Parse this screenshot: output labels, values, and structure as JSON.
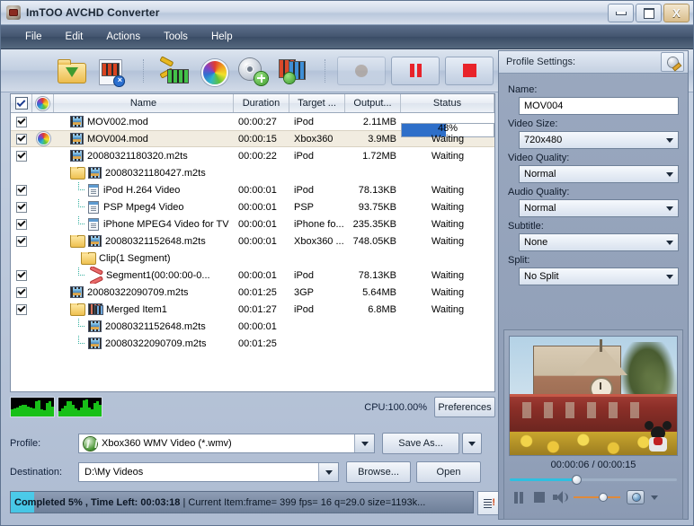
{
  "window": {
    "title": "ImTOO AVCHD Converter",
    "minimize_label": "Minimize",
    "maximize_label": "Maximize",
    "close_label": "X"
  },
  "menu": [
    {
      "label": "File"
    },
    {
      "label": "Edit"
    },
    {
      "label": "Actions"
    },
    {
      "label": "Tools"
    },
    {
      "label": "Help"
    }
  ],
  "toolbar": [
    {
      "name": "add-file",
      "icon": "folder-open-icon"
    },
    {
      "name": "remove-file",
      "icon": "film-delete-icon"
    },
    {
      "name": "clip",
      "icon": "scissors-film-icon"
    },
    {
      "name": "effect",
      "icon": "color-wheel-icon"
    },
    {
      "name": "settings",
      "icon": "gear-plus-icon"
    },
    {
      "name": "merge",
      "icon": "merge-films-icon"
    },
    {
      "name": "record",
      "icon": "record-dot-icon"
    },
    {
      "name": "pause",
      "icon": "pause-bars-icon"
    },
    {
      "name": "stop",
      "icon": "stop-square-icon"
    }
  ],
  "list": {
    "columns": [
      "",
      "",
      "Name",
      "Duration",
      "Target ...",
      "Output...",
      "Status"
    ],
    "rows": [
      {
        "checked": true,
        "wheel": false,
        "indent": 0,
        "icon": "film-icon",
        "name": "MOV002.mod",
        "duration": "00:00:27",
        "target": "iPod",
        "output": "2.11MB",
        "status": "48%",
        "progress": 48
      },
      {
        "checked": true,
        "wheel": true,
        "indent": 0,
        "icon": "film-icon",
        "name": "MOV004.mod",
        "duration": "00:00:15",
        "target": "Xbox360",
        "output": "3.9MB",
        "status": "Waiting",
        "selected": true
      },
      {
        "checked": true,
        "wheel": false,
        "indent": 0,
        "icon": "film-icon",
        "name": "20080321180320.m2ts",
        "duration": "00:00:22",
        "target": "iPod",
        "output": "1.72MB",
        "status": "Waiting"
      },
      {
        "checked": false,
        "wheel": false,
        "indent": 0,
        "icon": "folder-film-icon",
        "name": "20080321180427.m2ts",
        "duration": "",
        "target": "",
        "output": "",
        "status": ""
      },
      {
        "checked": true,
        "wheel": false,
        "indent": 1,
        "icon": "profile-doc-icon",
        "name": "iPod H.264 Video",
        "duration": "00:00:01",
        "target": "iPod",
        "output": "78.13KB",
        "status": "Waiting"
      },
      {
        "checked": true,
        "wheel": false,
        "indent": 1,
        "icon": "profile-doc-icon",
        "name": "PSP Mpeg4 Video",
        "duration": "00:00:01",
        "target": "PSP",
        "output": "93.75KB",
        "status": "Waiting"
      },
      {
        "checked": true,
        "wheel": false,
        "indent": 1,
        "icon": "profile-doc-icon",
        "name": "iPhone MPEG4 Video for TV",
        "duration": "00:00:01",
        "target": "iPhone fo...",
        "output": "235.35KB",
        "status": "Waiting"
      },
      {
        "checked": true,
        "wheel": false,
        "indent": 0,
        "icon": "folder-film-icon",
        "name": "20080321152648.m2ts",
        "duration": "00:00:01",
        "target": "Xbox360 ...",
        "output": "748.05KB",
        "status": "Waiting"
      },
      {
        "checked": false,
        "wheel": false,
        "indent": 0,
        "icon": "folder-icon",
        "name": "Clip(1 Segment)",
        "duration": "",
        "target": "",
        "output": "",
        "status": ""
      },
      {
        "checked": true,
        "wheel": false,
        "indent": 1,
        "icon": "scissors-icon",
        "name": "Segment1(00:00:00-0...",
        "duration": "00:00:01",
        "target": "iPod",
        "output": "78.13KB",
        "status": "Waiting"
      },
      {
        "checked": true,
        "wheel": false,
        "indent": 0,
        "icon": "film-icon",
        "name": "20080322090709.m2ts",
        "duration": "00:01:25",
        "target": "3GP",
        "output": "5.64MB",
        "status": "Waiting"
      },
      {
        "checked": true,
        "wheel": false,
        "indent": 0,
        "icon": "folder-films-icon",
        "name": "Merged Item1",
        "duration": "00:01:27",
        "target": "iPod",
        "output": "6.8MB",
        "status": "Waiting"
      },
      {
        "checked": false,
        "wheel": false,
        "indent": 1,
        "icon": "film-icon",
        "name": "20080321152648.m2ts",
        "duration": "00:00:01",
        "target": "",
        "output": "",
        "status": ""
      },
      {
        "checked": false,
        "wheel": false,
        "indent": 1,
        "icon": "film-icon",
        "name": "20080322090709.m2ts",
        "duration": "00:01:25",
        "target": "",
        "output": "",
        "status": ""
      }
    ]
  },
  "cpu": {
    "label": "CPU:100.00%",
    "preferences_label": "Preferences",
    "graph_a": [
      40,
      45,
      55,
      62,
      70,
      68,
      60,
      52,
      45,
      88,
      95,
      40,
      35,
      80,
      92,
      60
    ],
    "graph_b": [
      30,
      48,
      62,
      88,
      92,
      70,
      45,
      38,
      50,
      95,
      98,
      55,
      42,
      80,
      90,
      68
    ]
  },
  "profile_row": {
    "label": "Profile:",
    "value": "Xbox360 WMV Video (*.wmv)",
    "save_as_label": "Save As..."
  },
  "destination_row": {
    "label": "Destination:",
    "value": "D:\\My Videos",
    "browse_label": "Browse...",
    "open_label": "Open"
  },
  "status_bar": {
    "text_bold": "Completed 5% , Time Left: 00:03:18",
    "text_rest": " | Current Item:frame=  399 fps= 16 q=29.0 size=1193k...",
    "progress": 5
  },
  "profile_settings": {
    "header": "Profile Settings:",
    "fields": [
      {
        "label": "Name:",
        "value": "MOV004",
        "type": "text"
      },
      {
        "label": "Video Size:",
        "value": "720x480",
        "type": "combo"
      },
      {
        "label": "Video Quality:",
        "value": "Normal",
        "type": "combo"
      },
      {
        "label": "Audio Quality:",
        "value": "Normal",
        "type": "combo"
      },
      {
        "label": "Subtitle:",
        "value": "None",
        "type": "combo"
      },
      {
        "label": "Split:",
        "value": "No Split",
        "type": "combo"
      }
    ]
  },
  "preview": {
    "time": "00:00:06 / 00:00:15",
    "seek_percent": 40,
    "volume_percent": 55
  },
  "colors": {
    "accent_blue": "#2e6fc9",
    "panel_blue": "#9aa8bf",
    "menu_dark": "#43556f",
    "selection": "#f1ece0",
    "cpu_green": "#18c018",
    "seek_cyan": "#2fbfe0"
  }
}
